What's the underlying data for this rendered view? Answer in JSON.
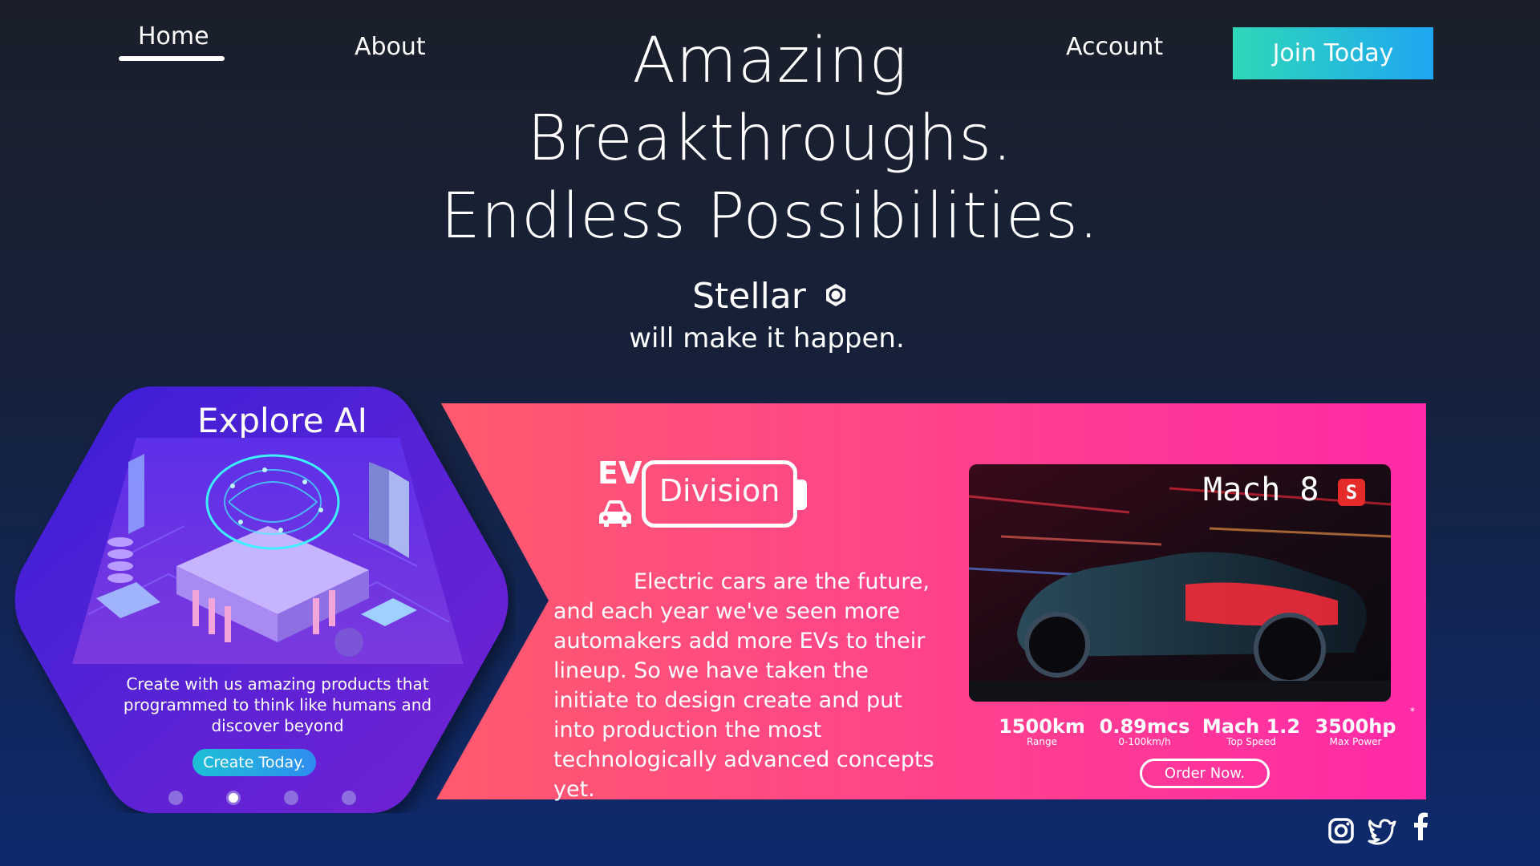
{
  "nav": {
    "home": "Home",
    "about": "About",
    "account": "Account",
    "join": "Join Today"
  },
  "hero": {
    "line1": "Amazing",
    "line2": "Breakthroughs.",
    "line3": "Endless Possibilities.",
    "brand": "Stellar",
    "tagline": "will make it happen."
  },
  "ai_card": {
    "title": "Explore AI",
    "description": "Create with us amazing products that programmed to think like humans and discover beyond",
    "button": "Create Today.",
    "carousel_active_index": 1,
    "carousel_count": 4
  },
  "ev": {
    "prefix": "EV",
    "division": "Division",
    "description": "Electric cars are the future, and each year we've seen more automakers add more EVs to their lineup. So we have taken the initiate to design create and put into production the most technologically advanced concepts yet.",
    "model": "Mach 8",
    "badge": "S",
    "asterisk": "*",
    "specs": [
      {
        "value": "1500km",
        "label": "Range"
      },
      {
        "value": "0.89mcs",
        "label": "0-100km/h"
      },
      {
        "value": "Mach 1.2",
        "label": "Top Speed"
      },
      {
        "value": "3500hp",
        "label": "Max Power"
      }
    ],
    "order_button": "Order Now."
  },
  "social": [
    "instagram-icon",
    "twitter-icon",
    "facebook-icon"
  ],
  "colors": {
    "join_gradient": [
      "#2fd8b8",
      "#1fa6f2"
    ],
    "banner_gradient": [
      "#ff5a6e",
      "#ff2aa8"
    ],
    "hex_gradient": [
      "#3a1fd8",
      "#6a22d6"
    ],
    "badge": "#e52a2a"
  }
}
